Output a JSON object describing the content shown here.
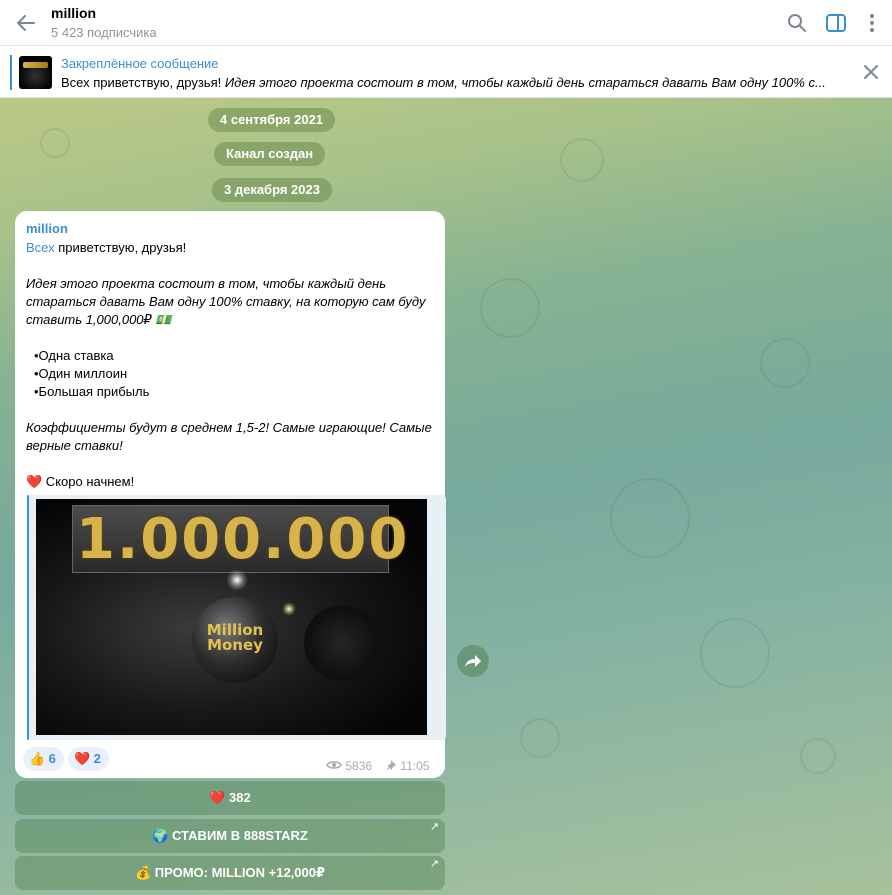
{
  "header": {
    "title": "million",
    "subtitle": "5 423 подписчика"
  },
  "pinned": {
    "label": "Закреплённое сообщение",
    "lead": "Всех приветствую, друзья! ",
    "rest": " Идея этого проекта состоит в том, чтобы каждый день стараться давать Вам одну 100% с..."
  },
  "dates": {
    "d1": "4 сентября 2021",
    "service": "Канал создан",
    "d2": "3 декабря 2023"
  },
  "message": {
    "author": "million",
    "greet_link": "Всех",
    "greet_rest": " приветствую, друзья!",
    "para1": "Идея этого проекта состоит в том, чтобы каждый день стараться давать Вам одну 100% ставку, на которую сам буду ставить 1,000,000₽ 💵",
    "bullet1": "•Одна ставка",
    "bullet2": "•Один миллоин",
    "bullet3": "•Большая прибыль",
    "para2": "Коэффициенты будут в среднем 1,5-2! Самые играющие! Самые верные ставки!",
    "closing_emoji": "❤️",
    "closing": " Скоро начнем!",
    "media_digits": "1.000.000",
    "media_coin": "Million Money",
    "views": "5836",
    "time": "11:05"
  },
  "reactions": [
    {
      "emoji": "👍",
      "count": "6"
    },
    {
      "emoji": "❤️",
      "count": "2"
    }
  ],
  "buttons": [
    {
      "label": "❤️ 382"
    },
    {
      "label": "🌍 СТАВИМ В 888STARZ",
      "arrow": "↗"
    },
    {
      "label": "💰 ПРОМО: MILLION +12,000₽",
      "arrow": "↗"
    }
  ],
  "colors": {
    "accent": "#3a8fd1",
    "bubble": "#ffffff",
    "reaction_bg": "#e8f1fb"
  }
}
